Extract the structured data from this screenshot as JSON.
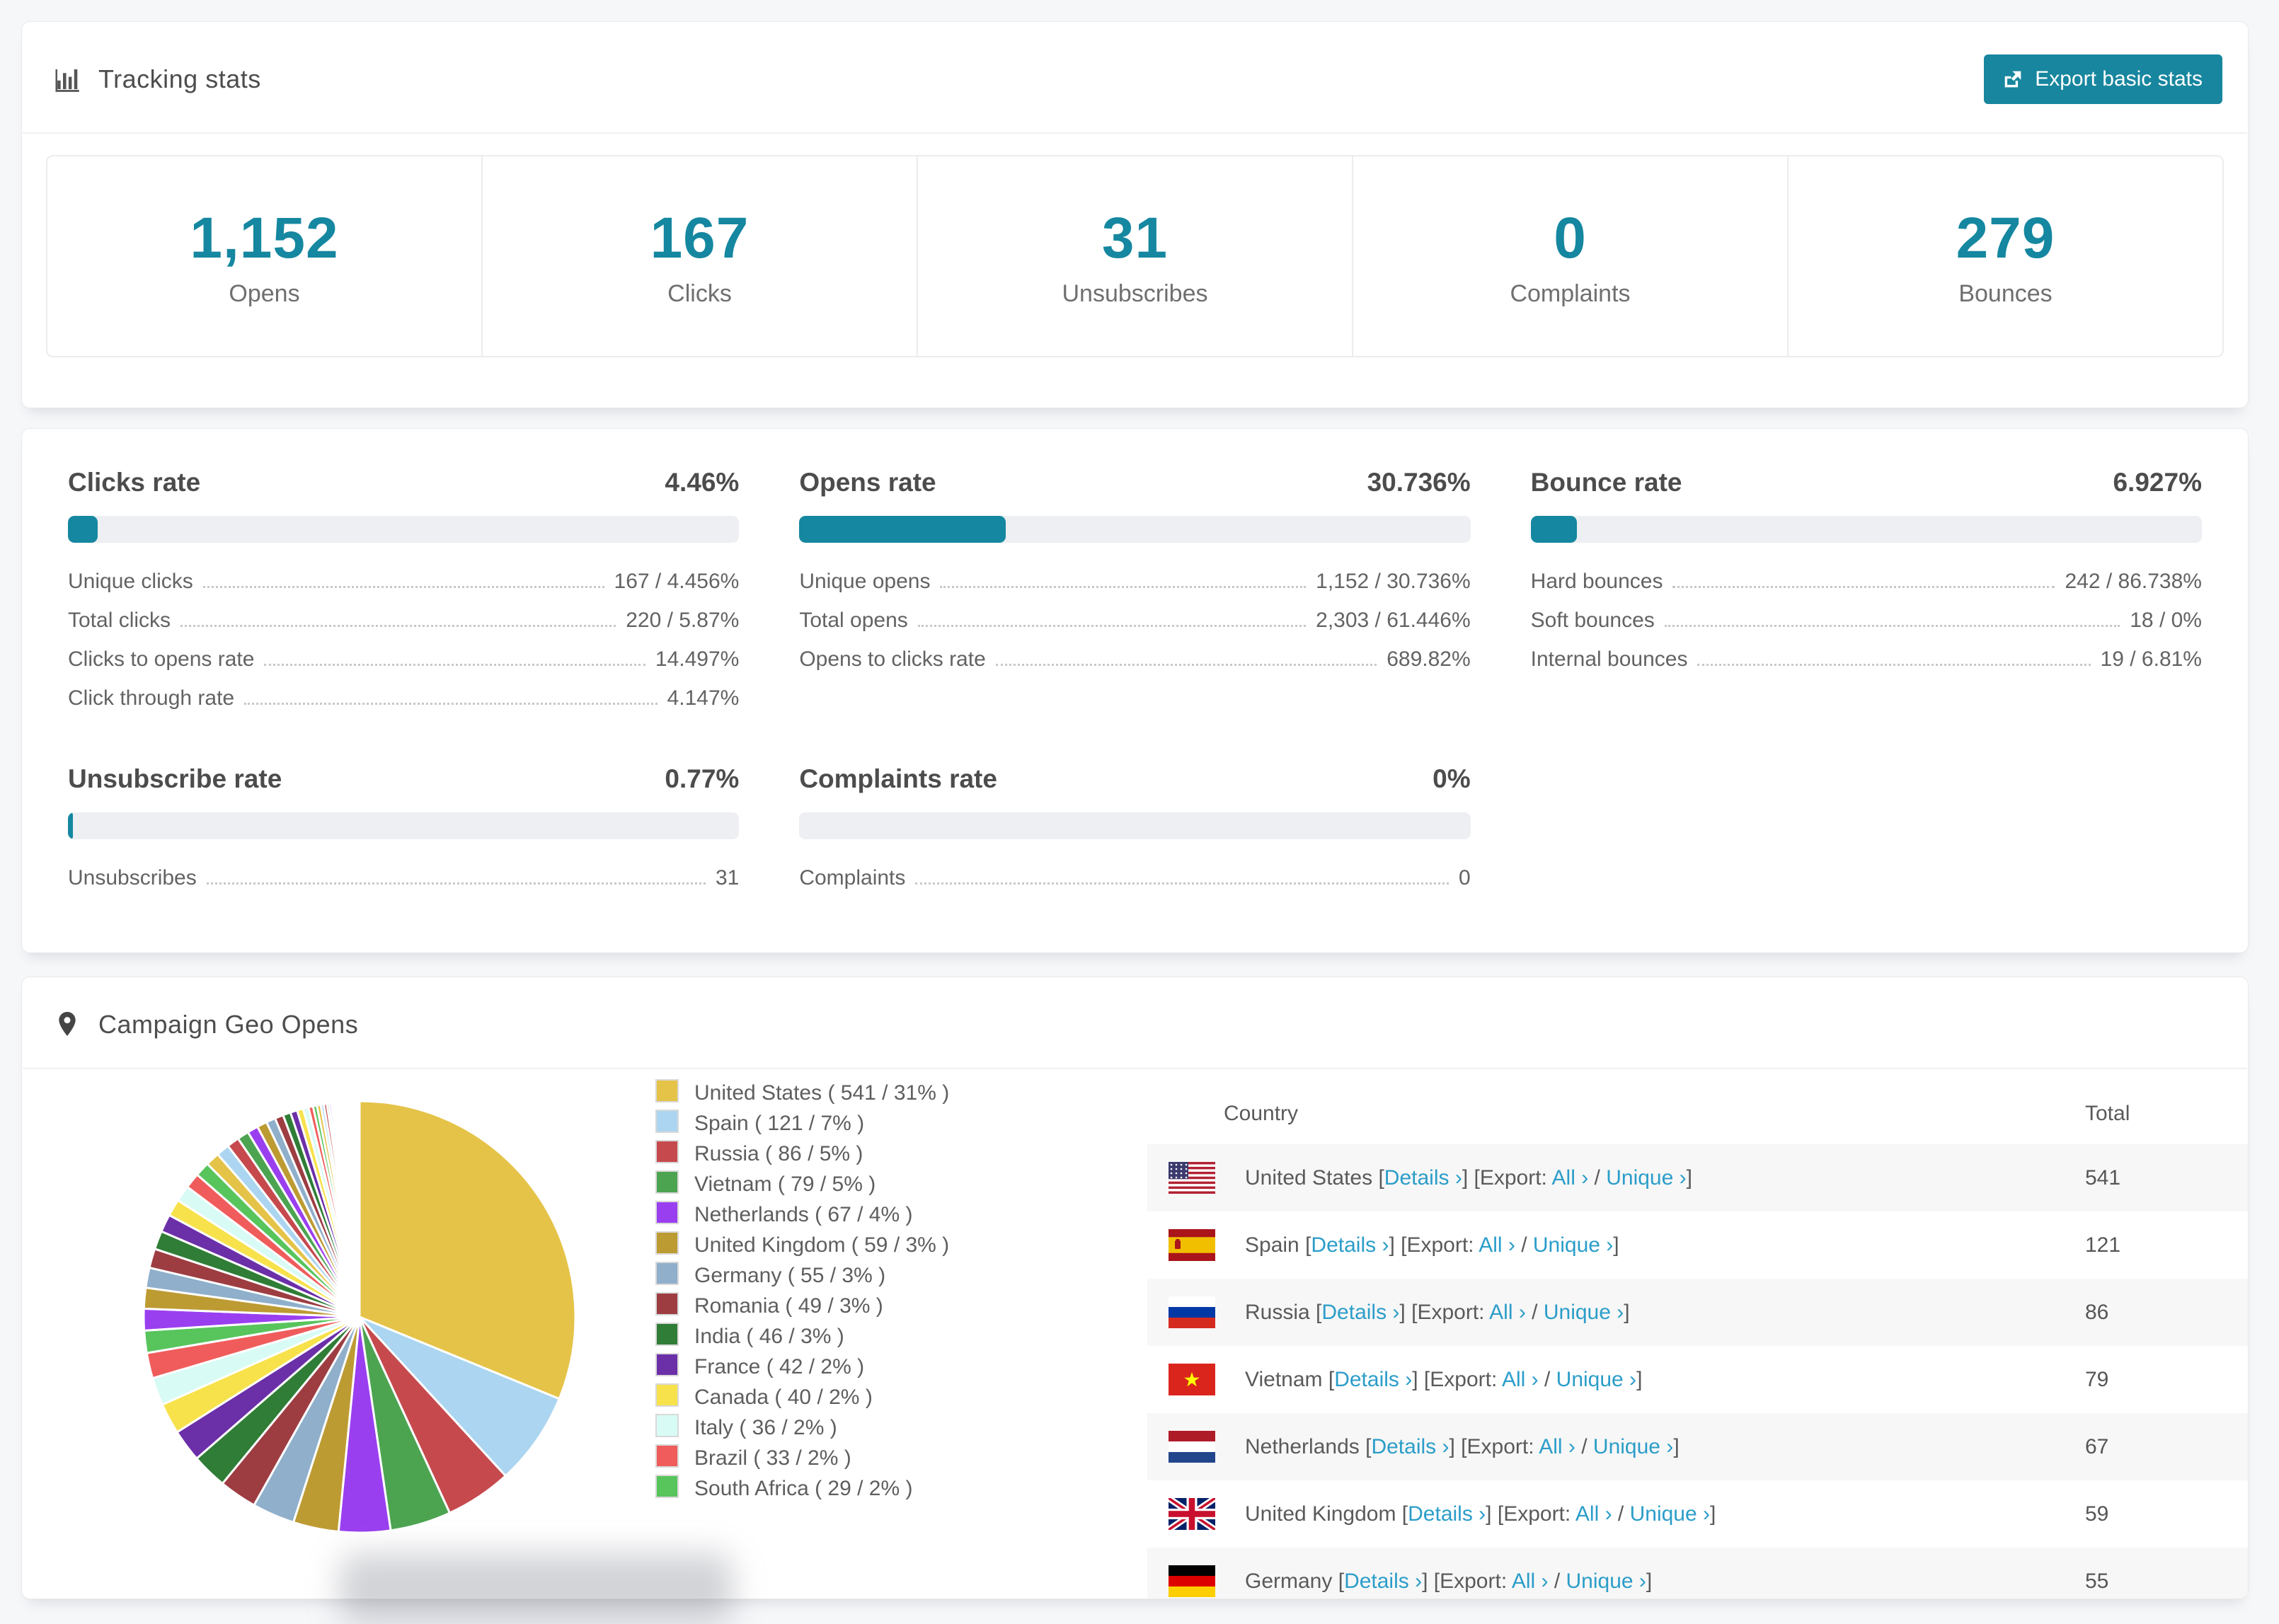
{
  "page": {
    "background": "#f6f7f9",
    "accent_teal": "#1587a0",
    "link_blue": "#2b9dc9"
  },
  "tracking": {
    "title": "Tracking stats",
    "icon": "bar-chart-icon",
    "export_button": "Export basic stats",
    "stats": [
      {
        "value": "1,152",
        "label": "Opens"
      },
      {
        "value": "167",
        "label": "Clicks"
      },
      {
        "value": "31",
        "label": "Unsubscribes"
      },
      {
        "value": "0",
        "label": "Complaints"
      },
      {
        "value": "279",
        "label": "Bounces"
      }
    ]
  },
  "rates": {
    "blocks": [
      {
        "title": "Clicks rate",
        "value": "4.46%",
        "percent": 4.46,
        "rows": [
          {
            "label": "Unique clicks",
            "value": "167 / 4.456%"
          },
          {
            "label": "Total clicks",
            "value": "220 / 5.87%"
          },
          {
            "label": "Clicks to opens rate",
            "value": "14.497%"
          },
          {
            "label": "Click through rate",
            "value": "4.147%"
          }
        ]
      },
      {
        "title": "Opens rate",
        "value": "30.736%",
        "percent": 30.736,
        "rows": [
          {
            "label": "Unique opens",
            "value": "1,152 / 30.736%"
          },
          {
            "label": "Total opens",
            "value": "2,303 / 61.446%"
          },
          {
            "label": "Opens to clicks rate",
            "value": "689.82%"
          }
        ]
      },
      {
        "title": "Bounce rate",
        "value": "6.927%",
        "percent": 6.927,
        "rows": [
          {
            "label": "Hard bounces",
            "value": "242 / 86.738%"
          },
          {
            "label": "Soft bounces",
            "value": "18 / 0%"
          },
          {
            "label": "Internal bounces",
            "value": "19 / 6.81%"
          }
        ]
      },
      {
        "title": "Unsubscribe rate",
        "value": "0.77%",
        "percent": 0.77,
        "rows": [
          {
            "label": "Unsubscribes",
            "value": "31"
          }
        ]
      },
      {
        "title": "Complaints rate",
        "value": "0%",
        "percent": 0,
        "rows": [
          {
            "label": "Complaints",
            "value": "0"
          }
        ]
      }
    ]
  },
  "geo": {
    "title": "Campaign Geo Opens",
    "icon": "map-pin-icon",
    "table": {
      "columns": [
        "Country",
        "Total"
      ],
      "details_label": "Details",
      "export_label": "Export:",
      "all_label": "All",
      "unique_label": "Unique",
      "chevron": "›",
      "rows": [
        {
          "country": "United States",
          "flag": "us",
          "total": "541"
        },
        {
          "country": "Spain",
          "flag": "es",
          "total": "121"
        },
        {
          "country": "Russia",
          "flag": "ru",
          "total": "86"
        },
        {
          "country": "Vietnam",
          "flag": "vn",
          "total": "79"
        },
        {
          "country": "Netherlands",
          "flag": "nl",
          "total": "67"
        },
        {
          "country": "United Kingdom",
          "flag": "gb",
          "total": "59"
        },
        {
          "country": "Germany",
          "flag": "de",
          "total": "55"
        }
      ]
    },
    "chart_data": {
      "type": "pie",
      "title": "Campaign Geo Opens",
      "legend_position": "right",
      "start_angle_deg": -90,
      "direction": "clockwise",
      "total_estimated": 1734,
      "slices": [
        {
          "label": "United States",
          "value": 541,
          "pct": 31,
          "color": "#E5C348"
        },
        {
          "label": "Spain",
          "value": 121,
          "pct": 7,
          "color": "#ABD5F0"
        },
        {
          "label": "Russia",
          "value": 86,
          "pct": 5,
          "color": "#C6494E"
        },
        {
          "label": "Vietnam",
          "value": 79,
          "pct": 5,
          "color": "#4CA451"
        },
        {
          "label": "Netherlands",
          "value": 67,
          "pct": 4,
          "color": "#9A3FF0"
        },
        {
          "label": "United Kingdom",
          "value": 59,
          "pct": 3,
          "color": "#BD9B33"
        },
        {
          "label": "Germany",
          "value": 55,
          "pct": 3,
          "color": "#8FAFCB"
        },
        {
          "label": "Romania",
          "value": 49,
          "pct": 3,
          "color": "#9D3D42"
        },
        {
          "label": "India",
          "value": 46,
          "pct": 3,
          "color": "#2F7D36"
        },
        {
          "label": "France",
          "value": 42,
          "pct": 2,
          "color": "#6B2FA8"
        },
        {
          "label": "Canada",
          "value": 40,
          "pct": 2,
          "color": "#F7E24B"
        },
        {
          "label": "Italy",
          "value": 36,
          "pct": 2,
          "color": "#D8FBF5"
        },
        {
          "label": "Brazil",
          "value": 33,
          "pct": 2,
          "color": "#F05C5C"
        },
        {
          "label": "South Africa",
          "value": 29,
          "pct": 2,
          "color": "#57C45C"
        }
      ],
      "others": {
        "note": "many small unlabeled countries rendered as thin slices",
        "values": [
          28,
          27,
          26,
          25,
          24,
          23,
          22,
          21,
          20,
          19,
          18,
          17,
          16,
          15,
          14,
          13,
          12,
          11,
          10,
          9,
          8,
          7,
          6,
          5,
          5,
          4,
          4,
          3,
          3,
          2,
          2,
          2,
          1,
          1,
          1,
          1,
          1,
          1,
          1,
          1,
          1,
          1,
          1,
          1,
          1,
          1,
          1,
          1,
          1,
          1,
          1,
          1,
          1,
          1,
          1,
          1,
          1,
          1,
          1,
          1,
          1,
          1
        ]
      }
    }
  }
}
